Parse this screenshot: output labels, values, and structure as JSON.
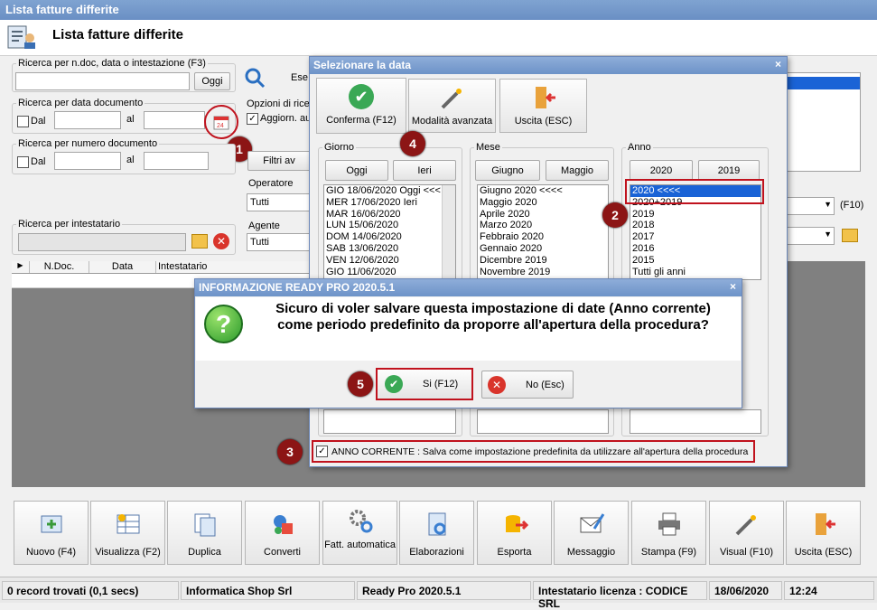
{
  "window": {
    "title": "Lista fatture differite",
    "header": "Lista fatture differite"
  },
  "search": {
    "ricerca_label": "Ricerca per n.doc, data o intestazione (F3)",
    "oggi": "Oggi",
    "data_doc_label": "Ricerca per data documento",
    "dal": "Dal",
    "al": "al",
    "num_doc_label": "Ricerca per numero documento",
    "intestatario_label": "Ricerca per intestatario",
    "ese": "Ese",
    "opzioni": "Opzioni di ricer",
    "aggiorn": "Aggiorn. au",
    "filtri": "Filtri av",
    "operatore": "Operatore",
    "operatore_val": "Tutti",
    "agente": "Agente",
    "agente_val": "Tutti",
    "f10": "(F10)"
  },
  "grid": {
    "columns": [
      "N.Doc.",
      "Data",
      "Intestatario"
    ]
  },
  "date_dialog": {
    "title": "Selezionare la data",
    "close": "×",
    "buttons": {
      "conferma": "Conferma (F12)",
      "avanzata": "Modalità avanzata",
      "uscita": "Uscita (ESC)"
    },
    "giorno": {
      "label": "Giorno",
      "b1": "Oggi",
      "b2": "Ieri",
      "items": [
        "GIO 18/06/2020 Oggi <<<",
        "MER 17/06/2020 Ieri",
        "MAR 16/06/2020",
        "LUN 15/06/2020",
        "DOM 14/06/2020",
        "SAB 13/06/2020",
        "VEN 12/06/2020",
        "GIO 11/06/2020"
      ]
    },
    "mese": {
      "label": "Mese",
      "b1": "Giugno",
      "b2": "Maggio",
      "items": [
        "Giugno 2020 <<<<",
        "Maggio 2020",
        "Aprile 2020",
        "Marzo 2020",
        "Febbraio 2020",
        "Gennaio 2020",
        "Dicembre 2019",
        "Novembre 2019"
      ]
    },
    "anno": {
      "label": "Anno",
      "b1": "2020",
      "b2": "2019",
      "items": [
        "2020 <<<<",
        "2020+2019",
        "2019",
        "2018",
        "2017",
        "2016",
        "2015",
        "Tutti gli anni"
      ]
    },
    "anno_corrente": "ANNO CORRENTE : Salva come impostazione predefinita da utilizzare all'apertura della procedura"
  },
  "info_dialog": {
    "title": "INFORMAZIONE READY PRO 2020.5.1",
    "close": "×",
    "line1": "Sicuro di voler salvare questa impostazione di date (Anno corrente)",
    "line2": "come periodo predefinito da proporre all'apertura della procedura?",
    "si": "Si (F12)",
    "no": "No (Esc)"
  },
  "badges": [
    "1",
    "2",
    "3",
    "4",
    "5"
  ],
  "toolbar": [
    "Nuovo (F4)",
    "Visualizza (F2)",
    "Duplica",
    "Converti",
    "Fatt. automatica",
    "Elaborazioni",
    "Esporta",
    "Messaggio",
    "Stampa (F9)",
    "Visual (F10)",
    "Uscita (ESC)"
  ],
  "status": {
    "records": "0 record trovati (0,1 secs)",
    "company": "Informatica Shop Srl",
    "version": "Ready Pro 2020.5.1",
    "license": "Intestatario licenza : CODICE SRL",
    "date": "18/06/2020",
    "time": "12:24"
  }
}
